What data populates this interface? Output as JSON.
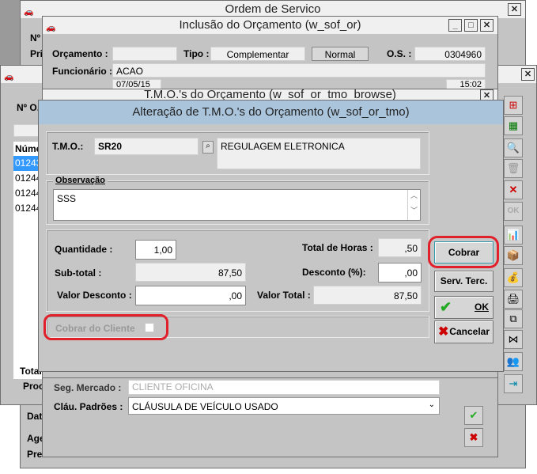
{
  "ordem_servico": {
    "title": "Ordem de Servico",
    "labels": [
      "Nº",
      "Pri",
      "Dat",
      "Age",
      "Pre"
    ]
  },
  "inclusao": {
    "title": "Inclusão do Orçamento (w_sof_or)",
    "orcamento_label": "Orçamento :",
    "orcamento_value": "",
    "tipo_label": "Tipo :",
    "tipo_complementar": "Complementar",
    "tipo_normal": "Normal",
    "os_label": "O.S. :",
    "os_value": "0304960",
    "funcionario_label": "Funcionário :",
    "funcionario_value": "ACAO",
    "date_value": "07/05/15",
    "time_value": "15:02",
    "seg_mercado_label": "Seg. Mercado :",
    "seg_mercado_value": "CLIENTE OFICINA",
    "clau_label": "Cláu. Padrões :",
    "clau_value": "CLÁUSULA DE VEÍCULO USADO"
  },
  "browse_parent": {
    "no_label": "Nº O.",
    "col_header": "Núme",
    "rows": [
      "01243",
      "01244",
      "01244",
      "01244"
    ],
    "total_label": "Total",
    "proc_label": "Proc"
  },
  "tmo_browse": {
    "title": "T.M.O.'s do Orçamento (w_sof_or_tmo_browse)"
  },
  "dialog": {
    "title": "Alteração de T.M.O.'s do Orçamento (w_sof_or_tmo)",
    "tmo_label": "T.M.O.:",
    "tmo_code": "SR20",
    "tmo_desc": "REGULAGEM ELETRONICA",
    "obs_label": "Observação",
    "obs_value": "SSS",
    "quantidade_label": "Quantidade :",
    "quantidade_value": "1,00",
    "total_horas_label": "Total de Horas :",
    "total_horas_value": ",50",
    "subtotal_label": "Sub-total :",
    "subtotal_value": "87,50",
    "desconto_pct_label": "Desconto (%):",
    "desconto_pct_value": ",00",
    "valor_desconto_label": "Valor Desconto :",
    "valor_desconto_value": ",00",
    "valor_total_label": "Valor Total :",
    "valor_total_value": "87,50",
    "cobrar_cliente_label": "Cobrar do Cliente",
    "cobrar_cliente_checked": false,
    "cobrar_btn": "Cobrar",
    "serv_terc_btn": "Serv. Terc.",
    "ok_btn": "OK",
    "cancelar_btn": "Cancelar"
  },
  "colors": {
    "highlight": "#e0202a",
    "dialog_title": "#aac4dc",
    "selection": "#3399ff"
  }
}
